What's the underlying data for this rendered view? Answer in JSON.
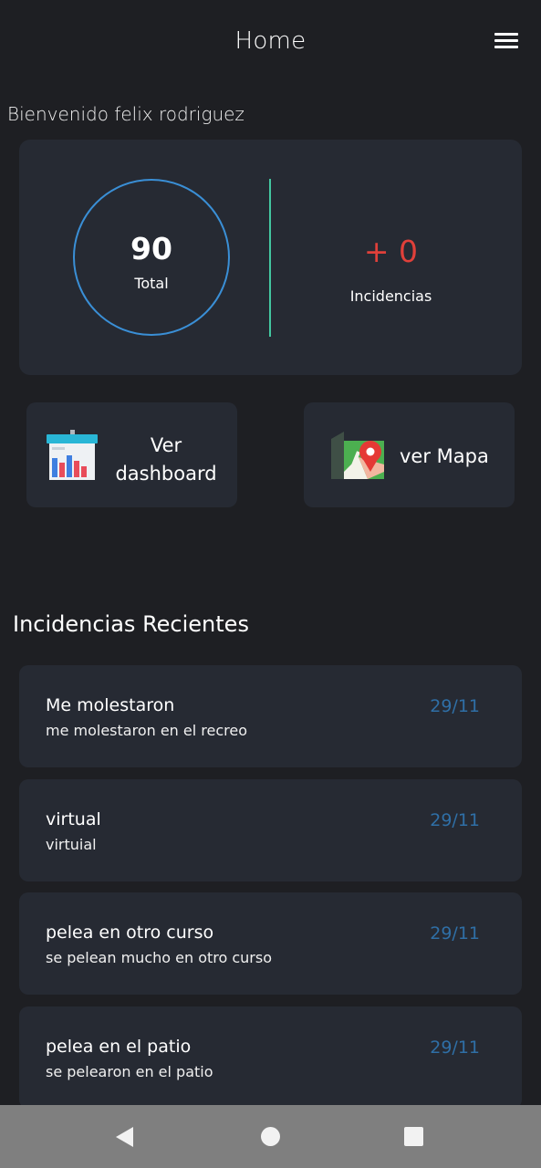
{
  "appbar": {
    "title": "Home",
    "menu_icon": "hamburger-menu-icon"
  },
  "welcome": "Bienvenido felix rodriguez",
  "stats": {
    "total_value": "90",
    "total_label": "Total",
    "incidents_value": "+ 0",
    "incidents_label": "Incidencias",
    "colors": {
      "ring": "#3a8fd6",
      "divider": "#43c7a0",
      "incidents": "#e0403a"
    }
  },
  "actions": {
    "dashboard": {
      "label": "Ver dashboard",
      "icon": "dashboard-chart-icon"
    },
    "map": {
      "label": "ver Mapa",
      "icon": "map-pin-icon"
    }
  },
  "recent": {
    "title": "Incidencias Recientes",
    "items": [
      {
        "title": "Me molestaron",
        "desc": "me molestaron en el recreo",
        "date": "29/11"
      },
      {
        "title": "virtual",
        "desc": "virtuial",
        "date": "29/11"
      },
      {
        "title": "pelea en otro curso",
        "desc": "se pelean mucho en otro curso",
        "date": "29/11"
      },
      {
        "title": "pelea en el patio",
        "desc": "se pelearon en el patio",
        "date": "29/11"
      }
    ]
  },
  "navbar": {
    "back_icon": "back-triangle-icon",
    "home_icon": "home-circle-icon",
    "recent_icon": "recent-apps-square-icon"
  }
}
